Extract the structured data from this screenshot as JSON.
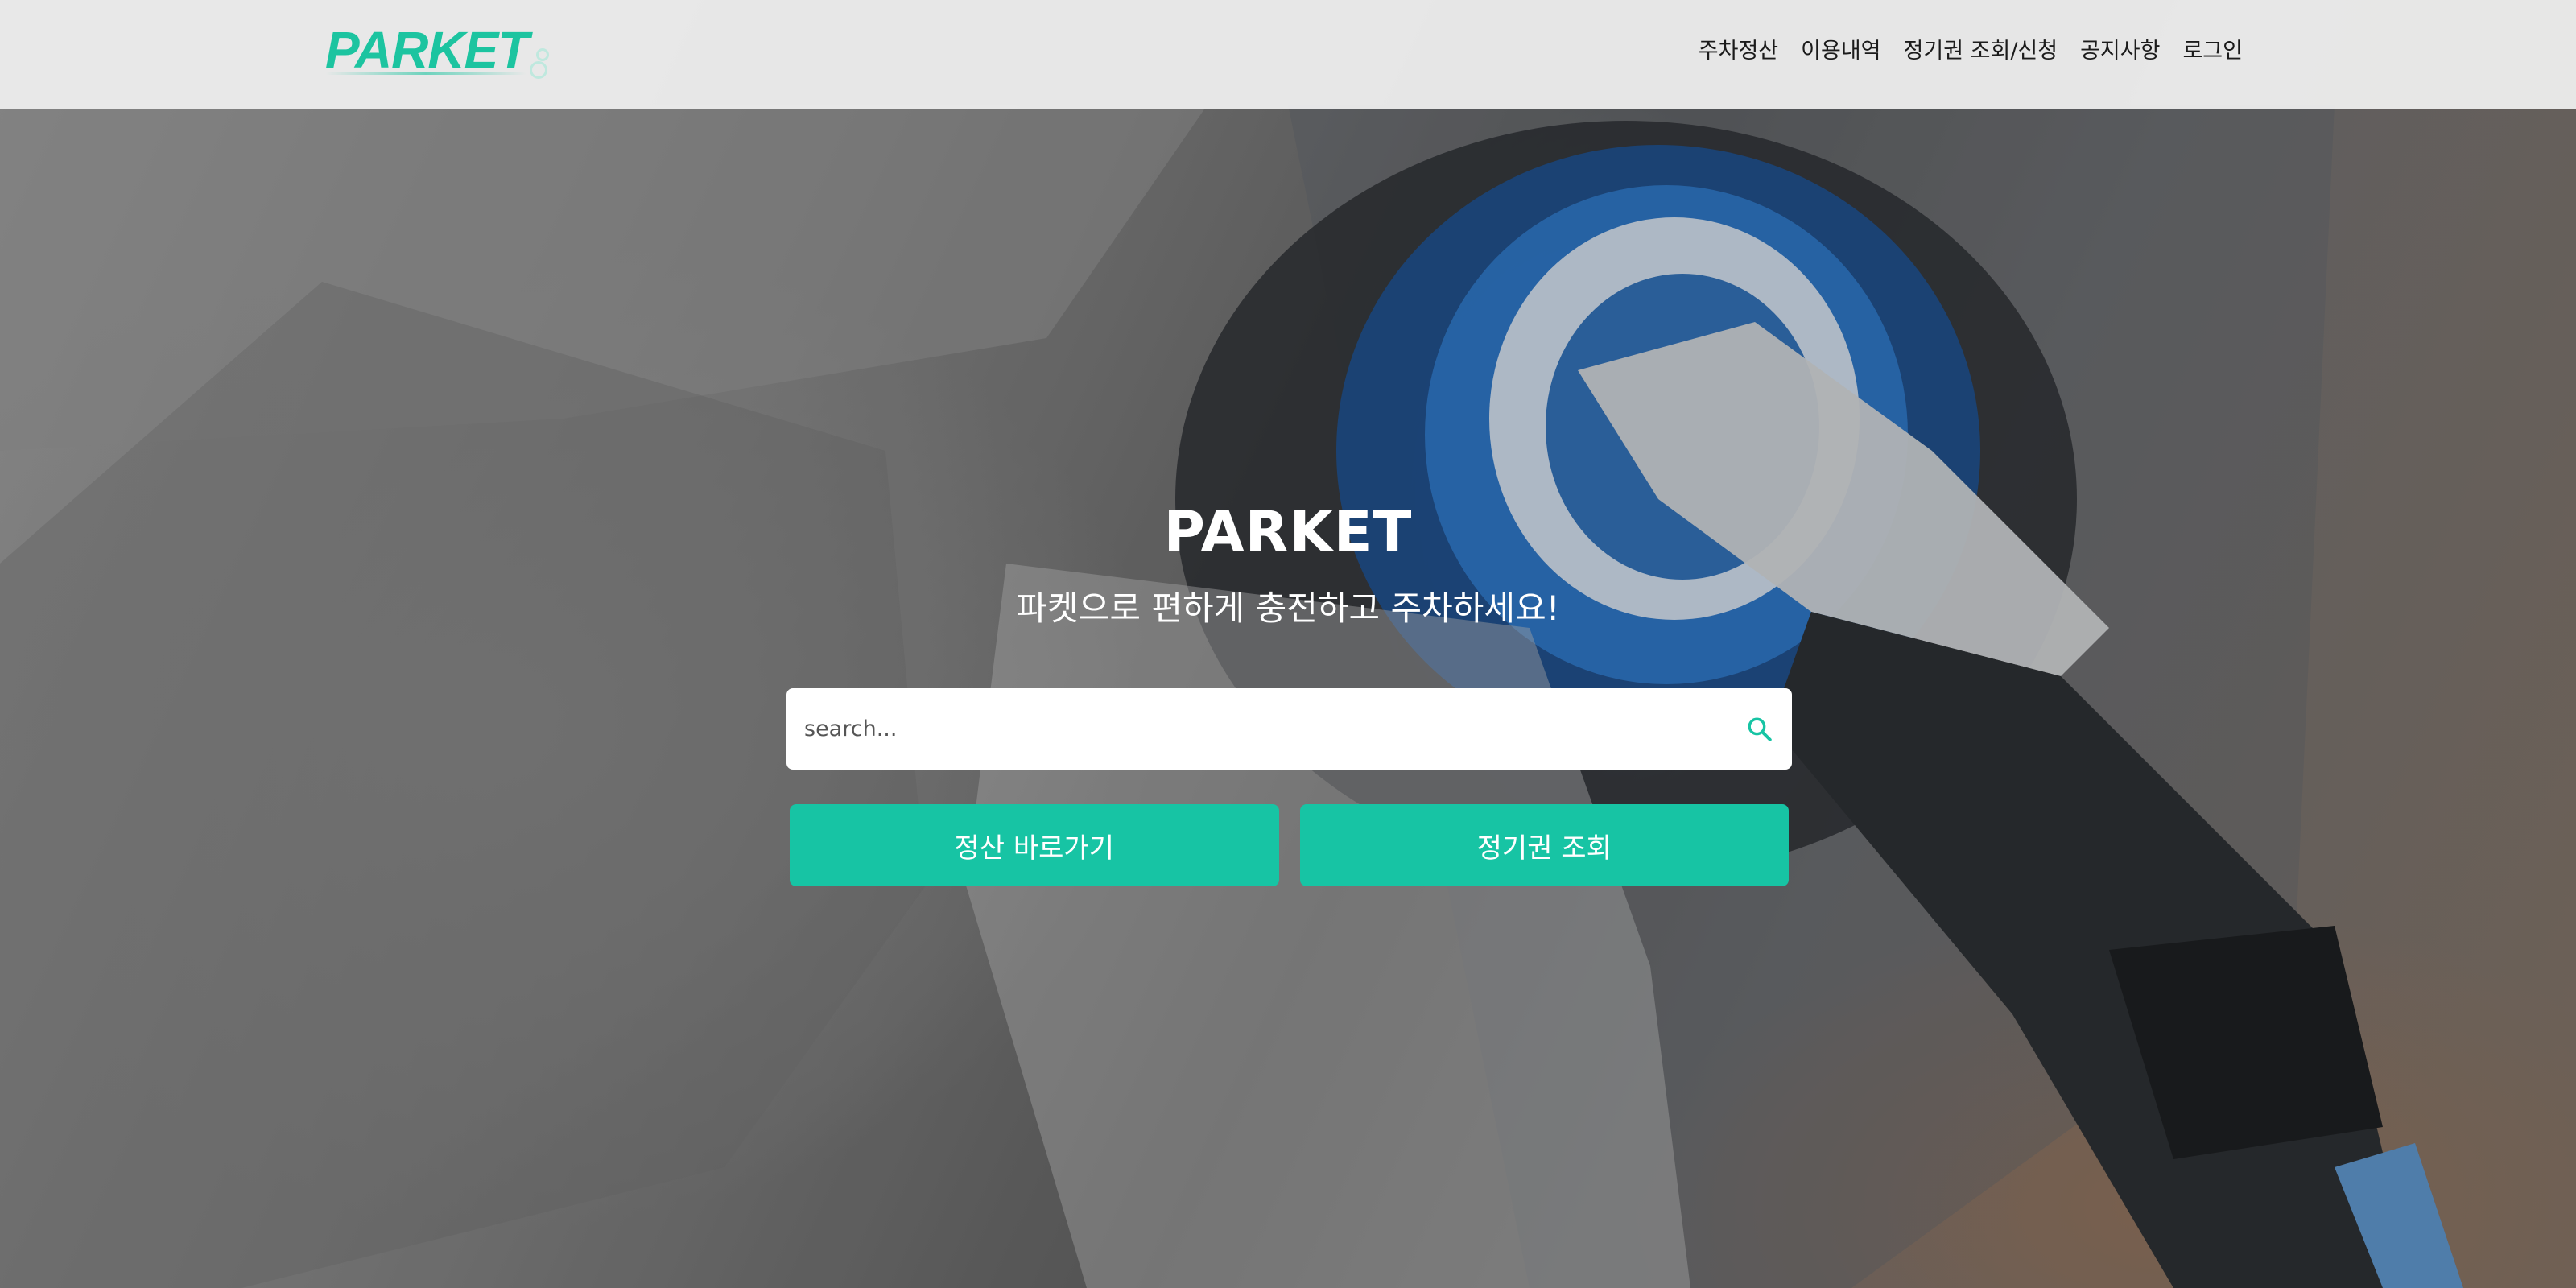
{
  "header": {
    "logo_text": "PARKET",
    "nav": [
      {
        "label": "주차정산"
      },
      {
        "label": "이용내역"
      },
      {
        "label": "정기권 조회/신청"
      },
      {
        "label": "공지사항"
      },
      {
        "label": "로그인"
      }
    ]
  },
  "hero": {
    "title": "PARKET",
    "subtitle": "파켓으로 편하게 충전하고 주차하세요!",
    "search": {
      "placeholder": "search...",
      "value": "",
      "icon": "search-icon"
    },
    "buttons": {
      "pay_label": "정산 바로가기",
      "pass_label": "정기권 조회"
    }
  },
  "colors": {
    "accent": "#17c4a4",
    "logo": "#1cc4a0",
    "header_bg": "#ececec"
  }
}
